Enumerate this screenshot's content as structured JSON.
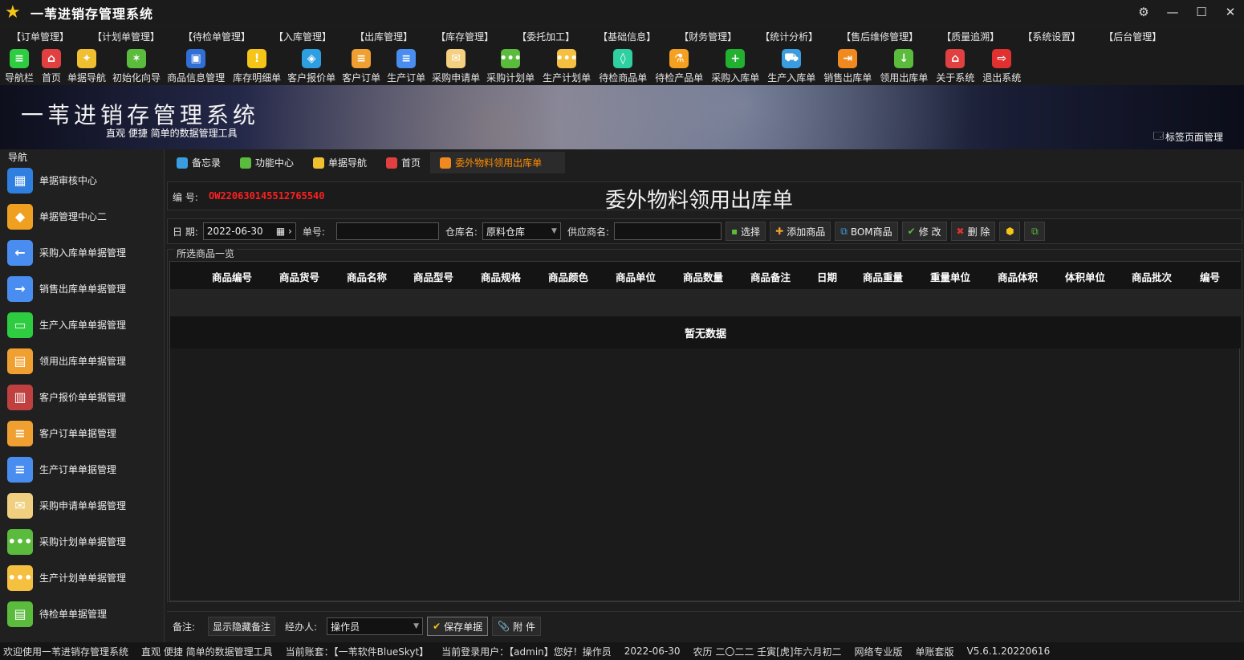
{
  "app": {
    "title": "一苇进销存管理系统"
  },
  "menu": [
    "【订单管理】",
    "【计划单管理】",
    "【待检单管理】",
    "【入库管理】",
    "【出库管理】",
    "【库存管理】",
    "【委托加工】",
    "【基础信息】",
    "【财务管理】",
    "【统计分析】",
    "【售后维修管理】",
    "【质量追溯】",
    "【系统设置】",
    "【后台管理】"
  ],
  "toolbar": [
    {
      "label": "导航栏",
      "icon": "menu-icon",
      "color": "#2ecc40",
      "glyph": "≡"
    },
    {
      "label": "首页",
      "icon": "home-icon",
      "color": "#e04040",
      "glyph": "⌂"
    },
    {
      "label": "单据导航",
      "icon": "compass-icon",
      "color": "#f0c030",
      "glyph": "✦"
    },
    {
      "label": "初始化向导",
      "icon": "wand-icon",
      "color": "#5bbb3c",
      "glyph": "✶"
    },
    {
      "label": "商品信息管理",
      "icon": "cubes-icon",
      "color": "#2f6fd6",
      "glyph": "▣"
    },
    {
      "label": "库存明细单",
      "icon": "warning-icon",
      "color": "#f5c518",
      "glyph": "!"
    },
    {
      "label": "客户报价单",
      "icon": "tag-icon",
      "color": "#2d9fe0",
      "glyph": "◈"
    },
    {
      "label": "客户订单",
      "icon": "doc-orange-icon",
      "color": "#f0a030",
      "glyph": "≡"
    },
    {
      "label": "生产订单",
      "icon": "doc-blue-icon",
      "color": "#4a8df0",
      "glyph": "≡"
    },
    {
      "label": "采购申请单",
      "icon": "mail-icon",
      "color": "#f5d080",
      "glyph": "✉"
    },
    {
      "label": "采购计划单",
      "icon": "chat-green-icon",
      "color": "#5bbb3c",
      "glyph": "•••"
    },
    {
      "label": "生产计划单",
      "icon": "chat-yellow-icon",
      "color": "#f5c040",
      "glyph": "•••"
    },
    {
      "label": "待检商品单",
      "icon": "flask-green-icon",
      "color": "#2ecfa0",
      "glyph": "◊"
    },
    {
      "label": "待检产品单",
      "icon": "flask-orange-icon",
      "color": "#f5a020",
      "glyph": "⚗"
    },
    {
      "label": "采购入库单",
      "icon": "plus-circle-icon",
      "color": "#22b030",
      "glyph": "+"
    },
    {
      "label": "生产入库单",
      "icon": "cart-icon",
      "color": "#3a9de0",
      "glyph": "⛟"
    },
    {
      "label": "销售出库单",
      "icon": "exit-box-icon",
      "color": "#f08a20",
      "glyph": "⇥"
    },
    {
      "label": "领用出库单",
      "icon": "download-icon",
      "color": "#5bbb3c",
      "glyph": "↓"
    },
    {
      "label": "关于系统",
      "icon": "house-icon",
      "color": "#e04040",
      "glyph": "⌂"
    },
    {
      "label": "退出系统",
      "icon": "logout-icon",
      "color": "#e03030",
      "glyph": "⇨"
    }
  ],
  "banner": {
    "title": "一苇进销存管理系统",
    "subtitle": "直观 便捷 简单的数据管理工具",
    "tag_manager": "标签页面管理"
  },
  "sidebar": {
    "title": "导航",
    "items": [
      {
        "label": "单据审核中心",
        "icon": "grid-blue-icon",
        "color": "#2f7fe0",
        "glyph": "▦"
      },
      {
        "label": "单据管理中心二",
        "icon": "grid-orange-icon",
        "color": "#f0a020",
        "glyph": "◆"
      },
      {
        "label": "采购入库单单据管理",
        "icon": "arrow-in-icon",
        "color": "#4a8df0",
        "glyph": "←"
      },
      {
        "label": "销售出库单单据管理",
        "icon": "arrow-out-icon",
        "color": "#4a8df0",
        "glyph": "→"
      },
      {
        "label": "生产入库单单据管理",
        "icon": "folder-green-icon",
        "color": "#2ecc40",
        "glyph": "▭"
      },
      {
        "label": "领用出库单单据管理",
        "icon": "folder-orange-icon",
        "color": "#f0a030",
        "glyph": "▤"
      },
      {
        "label": "客户报价单单据管理",
        "icon": "books-icon",
        "color": "#c04040",
        "glyph": "▥"
      },
      {
        "label": "客户订单单据管理",
        "icon": "doc-orange-icon",
        "color": "#f0a030",
        "glyph": "≡"
      },
      {
        "label": "生产订单单据管理",
        "icon": "doc-blue-icon",
        "color": "#4a8df0",
        "glyph": "≡"
      },
      {
        "label": "采购申请单单据管理",
        "icon": "mail-icon",
        "color": "#f0d080",
        "glyph": "✉"
      },
      {
        "label": "采购计划单单据管理",
        "icon": "chat-green-icon",
        "color": "#5bbb3c",
        "glyph": "•••"
      },
      {
        "label": "生产计划单单据管理",
        "icon": "chat-yellow-icon",
        "color": "#f5c040",
        "glyph": "•••"
      },
      {
        "label": "待检单单据管理",
        "icon": "doc-green-icon",
        "color": "#5bbb3c",
        "glyph": "▤"
      }
    ]
  },
  "tabs": [
    {
      "label": "备忘录",
      "icon": "memo-icon",
      "color": "#3a9de0"
    },
    {
      "label": "功能中心",
      "icon": "apps-icon",
      "color": "#5bbb3c"
    },
    {
      "label": "单据导航",
      "icon": "compass-icon",
      "color": "#f0c030"
    },
    {
      "label": "首页",
      "icon": "home-icon",
      "color": "#e04040"
    },
    {
      "label": "委外物料领用出库单",
      "icon": "outsource-icon",
      "color": "#f08a20",
      "active": true
    }
  ],
  "form": {
    "number_label": "编 号:",
    "number_value": "OW220630145512765540",
    "heading": "委外物料领用出库单",
    "date_label": "日 期:",
    "date_value": "2022-06-30",
    "order_no_label": "单号:",
    "order_no_value": "",
    "warehouse_label": "仓库名:",
    "warehouse_value": "原料仓库",
    "supplier_label": "供应商名:",
    "supplier_value": "",
    "buttons": {
      "select": "选择",
      "add_goods": "添加商品",
      "bom_goods": "BOM商品",
      "edit": "修 改",
      "delete": "删 除"
    }
  },
  "grid": {
    "title": "所选商品一览",
    "columns": [
      "商品编号",
      "商品货号",
      "商品名称",
      "商品型号",
      "商品规格",
      "商品颜色",
      "商品单位",
      "商品数量",
      "商品备注",
      "日期",
      "商品重量",
      "重量单位",
      "商品体积",
      "体积单位",
      "商品批次",
      "编号"
    ],
    "empty_text": "暂无数据"
  },
  "footer": {
    "remark_label": "备注:",
    "toggle_remark": "显示隐藏备注",
    "handler_label": "经办人:",
    "handler_value": "操作员",
    "save": "保存单据",
    "attach": "附 件"
  },
  "status": [
    "欢迎使用一苇进销存管理系统",
    "直观 便捷 简单的数据管理工具",
    "当前账套：【一苇软件BlueSkyt】",
    "当前登录用户：【admin】您好！操作员",
    "2022-06-30",
    "农历 二〇二二 壬寅[虎]年六月初二",
    "网络专业版",
    "单账套版",
    "V5.6.1.20220616"
  ]
}
